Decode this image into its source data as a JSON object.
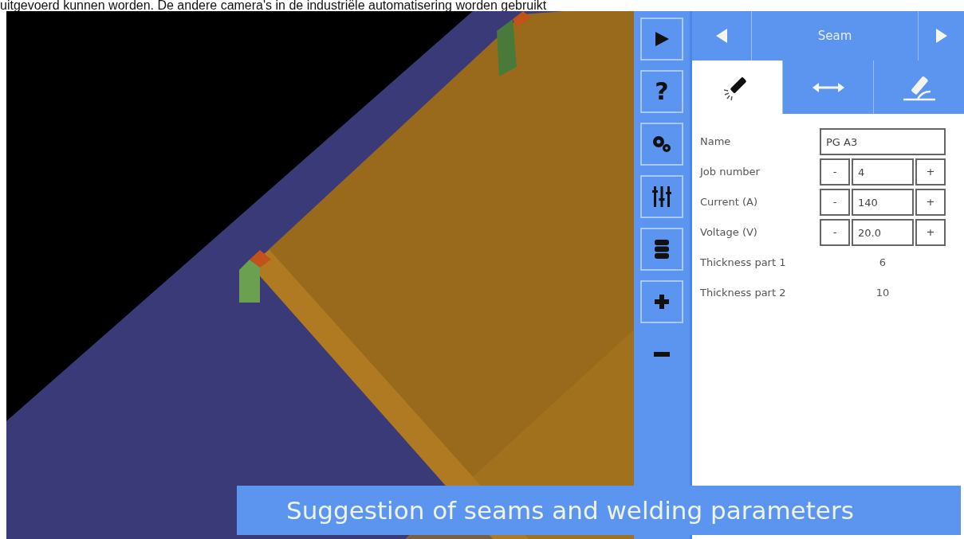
{
  "caption_above": "uitgevoerd kunnen worden. De andere camera's in de industriële automatisering worden gebruikt",
  "toolbar": [
    {
      "kind": "play"
    },
    {
      "kind": "help",
      "label": "?"
    },
    {
      "kind": "settings"
    },
    {
      "kind": "mixer"
    },
    {
      "kind": "database"
    },
    {
      "kind": "add"
    },
    {
      "kind": "remove"
    }
  ],
  "header": {
    "title": "Seam"
  },
  "tabs": [
    {
      "kind": "torch",
      "selected": true
    },
    {
      "kind": "distance",
      "selected": false
    },
    {
      "kind": "angle",
      "selected": false
    }
  ],
  "fields": [
    {
      "kind": "text",
      "label": "Name",
      "value": "PG A3"
    },
    {
      "kind": "stepper",
      "label": "Job number",
      "value": "4",
      "minus": "-",
      "plus": "+"
    },
    {
      "kind": "stepper",
      "label": "Current (A)",
      "value": "140",
      "minus": "-",
      "plus": "+"
    },
    {
      "kind": "stepper",
      "label": "Voltage (V)",
      "value": "20.0",
      "minus": "-",
      "plus": "+"
    },
    {
      "kind": "readout",
      "label": "Thickness part 1",
      "value": "6"
    },
    {
      "kind": "readout",
      "label": "Thickness part 2",
      "value": "10"
    }
  ],
  "banner": "Suggestion of seams and welding parameters"
}
